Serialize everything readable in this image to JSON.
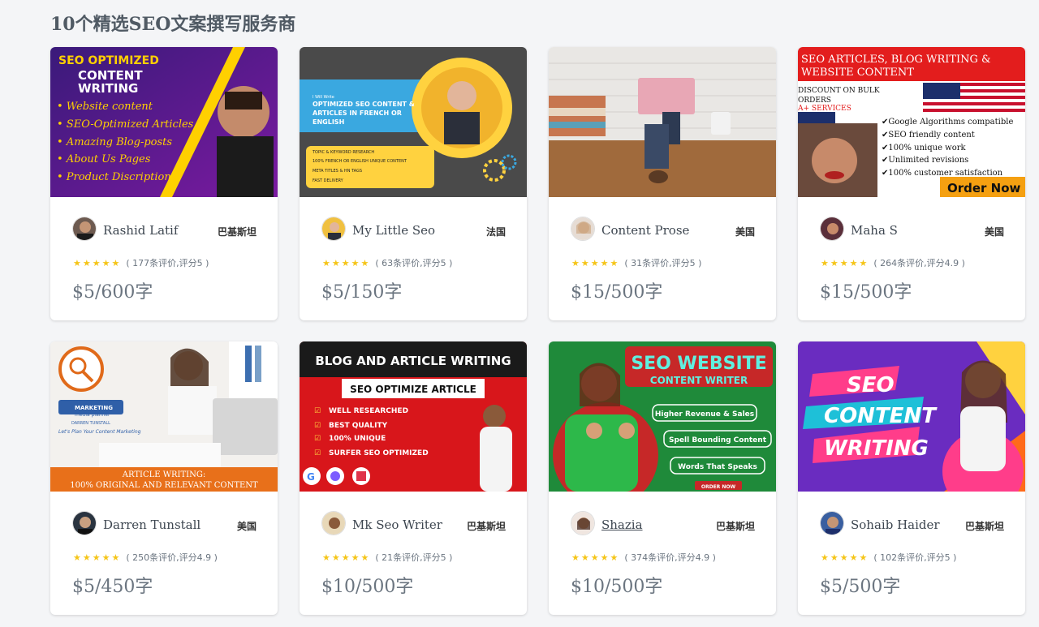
{
  "page": {
    "title": "10个精选SEO文案撰写服务商"
  },
  "cards": [
    {
      "thumb_lines": [
        "SEO OPTIMIZED",
        "CONTENT",
        "WRITING",
        "• Website content",
        "• SEO-Optimized Articles",
        "• Amazing Blog-posts",
        "• About Us Pages",
        "• Product Discription"
      ],
      "name": "Rashid Latif",
      "country": "巴基斯坦",
      "stars": "★★★★★",
      "reviews": "( 177条评价,评分5 )",
      "price": "$5/600字"
    },
    {
      "thumb_lines": [
        "I Will Write",
        "OPTIMIZED SEO CONTENT &",
        "ARTICLES IN FRENCH OR",
        "ENGLISH",
        "TOPIC & KEYWORD RESEARCH",
        "100% FRENCH OR ENGLISH UNIQUE CONTENT",
        "META TITLES & HN TAGS",
        "FAST DELIVERY"
      ],
      "name": "My Little Seo",
      "country": "法国",
      "stars": "★★★★★",
      "reviews": "( 63条评价,评分5 )",
      "price": "$5/150字"
    },
    {
      "thumb_lines": [],
      "name": "Content Prose",
      "country": "美国",
      "stars": "★★★★★",
      "reviews": "( 31条评价,评分5 )",
      "price": "$15/500字"
    },
    {
      "thumb_lines": [
        "SEO ARTICLES, BLOG WRITING &",
        "WEBSITE CONTENT",
        "DISCOUNT ON BULK",
        "ORDERS",
        "A+ SERVICES",
        "✔Google Algorithms compatible",
        "✔SEO friendly content",
        "✔100% unique work",
        "✔Unlimited revisions",
        "✔100% customer satisfaction",
        "Order Now"
      ],
      "name": "Maha S",
      "country": "美国",
      "stars": "★★★★★",
      "reviews": "( 264条评价,评分4.9 )",
      "price": "$15/500字"
    },
    {
      "thumb_lines": [
        "MARKETING",
        "media planner",
        "DARREN TUNSTALL",
        "Let's Plan Your Content Marketing",
        "ARTICLE WRITING:",
        "100% ORIGINAL AND RELEVANT CONTENT"
      ],
      "name": "Darren Tunstall",
      "country": "美国",
      "stars": "★★★★★",
      "reviews": "( 250条评价,评分4.9 )",
      "price": "$5/450字"
    },
    {
      "thumb_lines": [
        "BLOG AND ARTICLE WRITING",
        "SEO OPTIMIZE ARTICLE",
        "WELL RESEARCHED",
        "BEST QUALITY",
        "100% UNIQUE",
        "SURFER SEO OPTIMIZED"
      ],
      "name": "Mk Seo Writer",
      "country": "巴基斯坦",
      "stars": "★★★★★",
      "reviews": "( 21条评价,评分5 )",
      "price": "$10/500字"
    },
    {
      "thumb_lines": [
        "SEO WEBSITE",
        "CONTENT WRITER",
        "Higher Revenue & Sales",
        "Spell Bounding Content",
        "Words That Speaks",
        "ORDER NOW"
      ],
      "name": "Shazia",
      "country": "巴基斯坦",
      "stars": "★★★★★",
      "reviews": "( 374条评价,评分4.9 )",
      "price": "$10/500字"
    },
    {
      "thumb_lines": [
        "SEO",
        "CONTENT",
        "WRITING"
      ],
      "name": "Sohaib Haider",
      "country": "巴基斯坦",
      "stars": "★★★★★",
      "reviews": "( 102条评价,评分5 )",
      "price": "$5/500字"
    }
  ]
}
